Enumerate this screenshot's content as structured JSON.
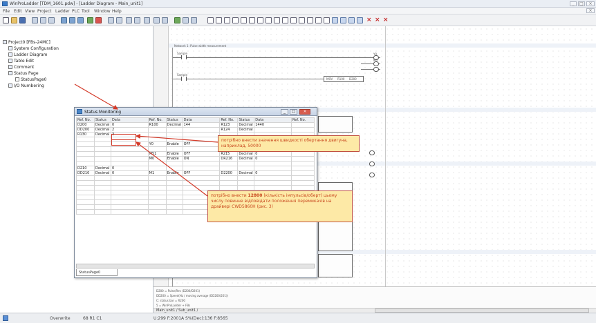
{
  "window": {
    "title": "WinProLadder [TDM_1601.pdw] - [Ladder Diagram - Main_unit1]"
  },
  "menu": [
    "File",
    "Edit",
    "View",
    "Project",
    "Ladder",
    "PLC",
    "Tool",
    "Window",
    "Help"
  ],
  "tree": {
    "items": [
      {
        "label": "Project0 [FBs-24MC]",
        "indent": 0
      },
      {
        "label": "System Configuration",
        "indent": 1
      },
      {
        "label": "Ladder Diagram",
        "indent": 1
      },
      {
        "label": "Table Edit",
        "indent": 1
      },
      {
        "label": "Comment",
        "indent": 1
      },
      {
        "label": "Status Page",
        "indent": 1
      },
      {
        "label": "StatusPage0",
        "indent": 2
      },
      {
        "label": "I/O Numbering",
        "indent": 1
      }
    ]
  },
  "status_window": {
    "title": "Status Monitoring",
    "tab": "StatusPage0",
    "columns": [
      "Ref. No.",
      "Status",
      "Data",
      "Ref. No.",
      "Status",
      "Data",
      "Ref. No.",
      "Status",
      "Data",
      "Ref. No."
    ],
    "rows": [
      [
        "D200",
        "Decimal",
        "0",
        "R100",
        "Decimal",
        "144",
        "R123",
        "Decimal",
        "1440",
        ""
      ],
      [
        "DD200",
        "Decimal",
        "2",
        "",
        "",
        "",
        "R124",
        "Decimal",
        "",
        ""
      ],
      [
        "R130",
        "Decimal",
        "3",
        "",
        "",
        "",
        "",
        "",
        "",
        ""
      ],
      [
        "",
        "",
        "",
        "",
        "",
        "",
        "",
        "",
        "",
        ""
      ],
      [
        "",
        "",
        "",
        "Y0",
        "Enable",
        "OFF",
        "",
        "",
        "",
        ""
      ],
      [
        "",
        "",
        "",
        "",
        "",
        "",
        "",
        "",
        "",
        ""
      ],
      [
        "",
        "",
        "",
        "M51",
        "Enable",
        "OFF",
        "R215",
        "Decimal",
        "0",
        ""
      ],
      [
        "",
        "",
        "",
        "M0",
        "Enable",
        "ON",
        "DR216",
        "Decimal",
        "0",
        ""
      ],
      [
        "",
        "",
        "",
        "",
        "",
        "",
        "",
        "",
        "",
        ""
      ],
      [
        "D210",
        "Decimal",
        "0",
        "",
        "",
        "",
        "",
        "",
        "",
        ""
      ],
      [
        "DD210",
        "Decimal",
        "0",
        "M1",
        "Enable",
        "OFF",
        "D2200",
        "Decimal",
        "0",
        ""
      ]
    ]
  },
  "callouts": {
    "speed": "потрібно внести значення швидкості обертання двигуна, наприклад, 50000",
    "pulses_prefix": "потрібно внести ",
    "pulses_value": "12800",
    "pulses_rest": " (кількість імпульсів/оберт) цьому числу повинне відповідати положення перемикачів на драйвері CWD5860H (рис. 3)"
  },
  "ladder": {
    "labels": [
      "Network 1: Pulse width measurement",
      "Sample",
      "Y0",
      "M0",
      "Sample",
      "MOV",
      "R100",
      "D200",
      "M1",
      "M51"
    ],
    "bottom_notes": [
      "D200 = Pulse/Rev (D200/D201)",
      "DD200 = Speed(Hz / moving average (DD200/201))",
      "C: status bar = R200",
      "5 = WinProLadder + FBs"
    ],
    "bottom_tabs": "Main_unit1 / Sub_unit1 /"
  },
  "statusbar": {
    "mode": "Overwrite",
    "pos": "68 R1 C1",
    "plc": "U:299 F:2001A S%(Dec):136 F:8565"
  },
  "colors": {
    "callout_bg": "#fde9a6",
    "callout_text": "#c8471e",
    "arrow": "#d43b2a"
  }
}
